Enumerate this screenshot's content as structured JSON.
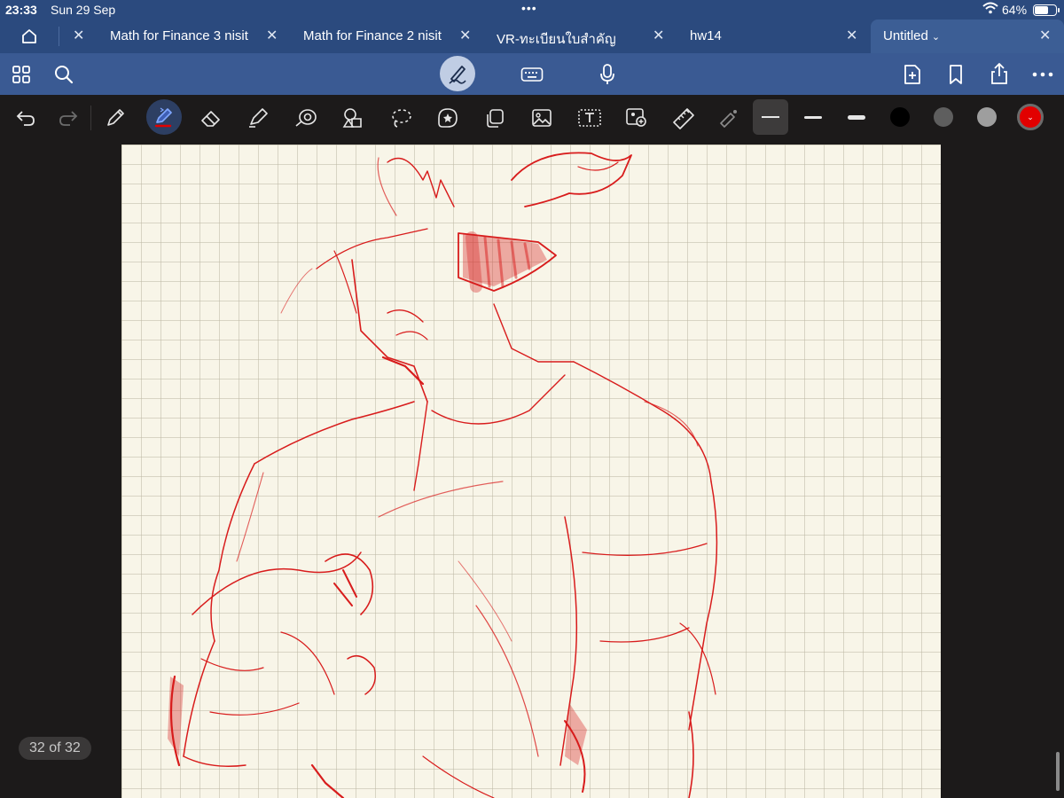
{
  "status": {
    "time": "23:33",
    "date": "Sun 29 Sep",
    "battery": "64%"
  },
  "tabs": [
    {
      "label": "Math for Finance 3 nisit"
    },
    {
      "label": "Math for Finance 2 nisit"
    },
    {
      "label": "VR-ทะเบียนใบสำคัญ"
    },
    {
      "label": "hw14"
    },
    {
      "label": "Untitled",
      "active": true
    }
  ],
  "close_glyph": "✕",
  "page_indicator": "32 of 32",
  "colors": {
    "chrome": "#2b4a7e",
    "toolbar": "#3a5a93",
    "paper": "#f8f5e8",
    "ink": "#d81c1c",
    "swatches": [
      "#000000",
      "#5e5e5e",
      "#9e9e9e",
      "#e20000"
    ]
  },
  "icons": {
    "app_toolbar": [
      "thumbnails-icon",
      "search-icon",
      "pen-mode-icon",
      "keyboard-icon",
      "microphone-icon",
      "add-page-icon",
      "bookmark-icon",
      "share-icon",
      "more-icon"
    ],
    "draw_toolbar": [
      "undo-icon",
      "redo-icon",
      "pen-icon",
      "bluetooth-pen-icon",
      "eraser-icon",
      "highlighter-icon",
      "shape-icon",
      "elements-icon",
      "lasso-icon",
      "sticker-icon",
      "copy-icon",
      "image-icon",
      "text-icon",
      "camera-icon",
      "ruler-icon",
      "laser-pointer-icon"
    ]
  }
}
